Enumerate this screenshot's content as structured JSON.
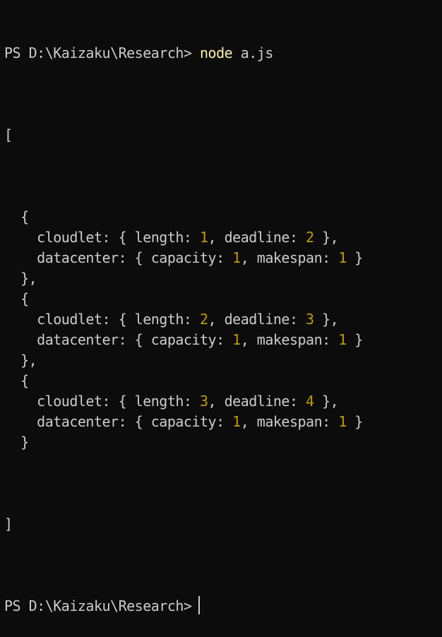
{
  "colors": {
    "background": "#0c0c0c",
    "text": "#cccccc",
    "command": "#f9f1a5",
    "number": "#c19c00"
  },
  "prompt": {
    "path": "PS D:\\Kaizaku\\Research>",
    "command": "node",
    "args": "a.js"
  },
  "output": {
    "open_bracket": "[",
    "close_bracket": "]",
    "items": [
      {
        "cloudlet": {
          "length": "1",
          "deadline": "2"
        },
        "datacenter": {
          "capacity": "1",
          "makespan": "1"
        }
      },
      {
        "cloudlet": {
          "length": "2",
          "deadline": "3"
        },
        "datacenter": {
          "capacity": "1",
          "makespan": "1"
        }
      },
      {
        "cloudlet": {
          "length": "3",
          "deadline": "4"
        },
        "datacenter": {
          "capacity": "1",
          "makespan": "1"
        }
      }
    ]
  },
  "final_prompt": {
    "path": "PS D:\\Kaizaku\\Research>"
  }
}
